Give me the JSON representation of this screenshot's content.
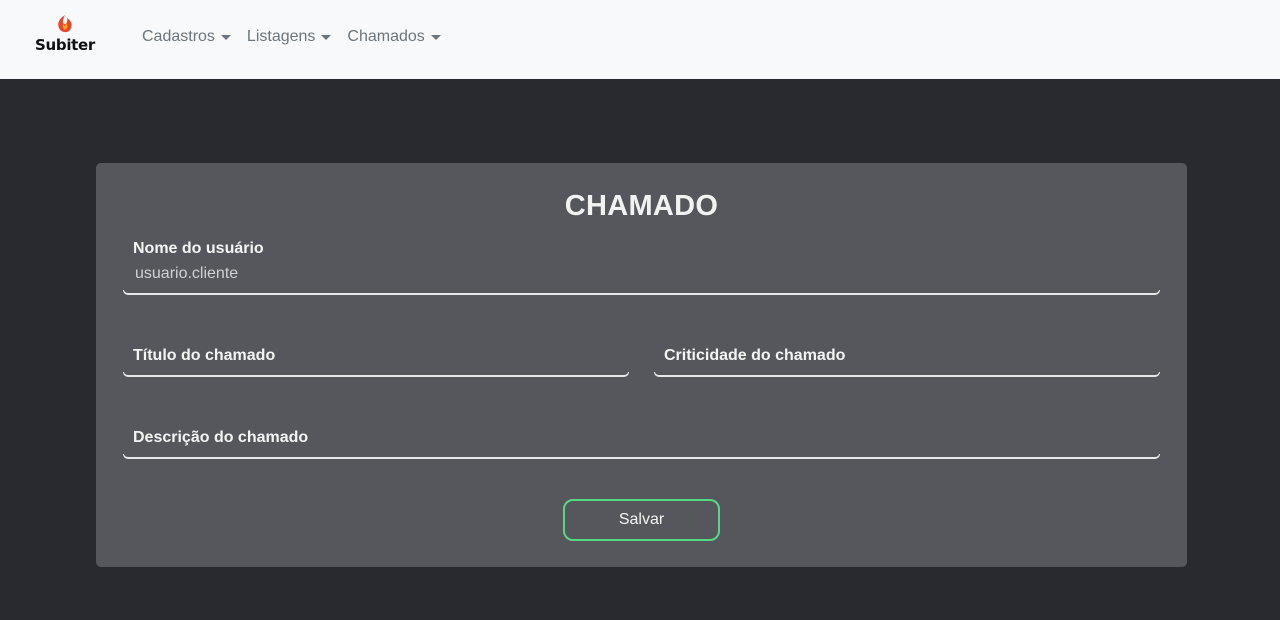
{
  "brand": {
    "name": "Subiter",
    "accent": "#e8462a",
    "accent2": "#f6a52a"
  },
  "nav": {
    "items": [
      {
        "label": "Cadastros"
      },
      {
        "label": "Listagens"
      },
      {
        "label": "Chamados"
      }
    ]
  },
  "form": {
    "title": "CHAMADO",
    "fields": {
      "user_name": {
        "label": "Nome do usuário",
        "value": "usuario.cliente"
      },
      "ticket_title": {
        "label": "Título do chamado",
        "value": ""
      },
      "criticality": {
        "label": "Criticidade do chamado",
        "value": ""
      },
      "description": {
        "label": "Descrição do chamado",
        "value": ""
      }
    },
    "save_label": "Salvar"
  },
  "colors": {
    "page_bg": "#282a2f",
    "navbar_bg": "#f8f9fa",
    "card_bg": "#55575c",
    "button_border": "#56d983"
  }
}
